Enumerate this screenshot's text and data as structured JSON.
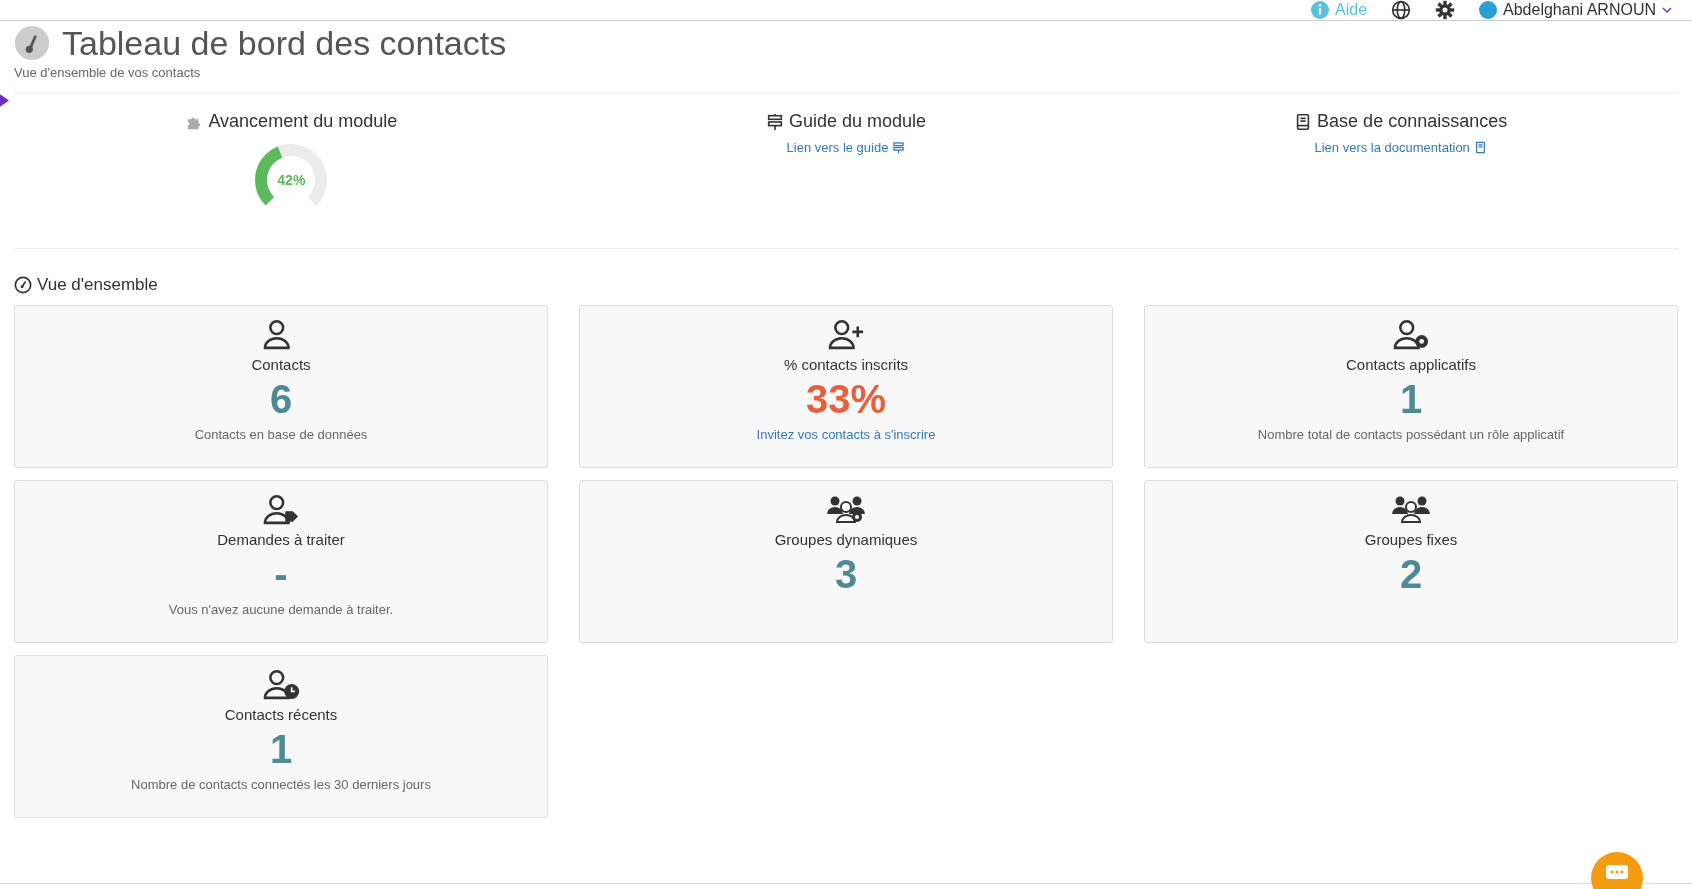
{
  "top_bar": {
    "help": "Aide",
    "user": "Abdelghani ARNOUN"
  },
  "header": {
    "title": "Tableau de bord des contacts",
    "subtitle": "Vue d'ensemble de vos contacts"
  },
  "module": {
    "progress": {
      "title": "Avancement du module",
      "level": 0.42,
      "reading": "42%"
    },
    "guide": {
      "title": "Guide du module",
      "link": "Lien vers le guide"
    },
    "docs": {
      "title": "Base de connaissances",
      "link": "Lien vers la documentation"
    }
  },
  "overview": {
    "title": "Vue d'ensemble",
    "cards": [
      {
        "kind": "person",
        "title": "Contacts",
        "value": "6",
        "color": "#4e8a96",
        "note": {
          "kind": "text",
          "text": "Contacts en base de données"
        }
      },
      {
        "kind": "person-plus",
        "title": "% contacts inscrits",
        "value": "33%",
        "color": "#e5603d",
        "note": {
          "kind": "link",
          "text": "Invitez vos contacts à s'inscrire"
        }
      },
      {
        "kind": "person-gear",
        "title": "Contacts applicatifs",
        "value": "1",
        "color": "#4e8a96",
        "note": {
          "kind": "text",
          "text": "Nombre total de contacts possédant un rôle applicatif"
        }
      },
      {
        "kind": "person-tag",
        "title": "Demandes à traiter",
        "value": "-",
        "color": "#4e8a96",
        "note": {
          "kind": "text",
          "text": "Vous n'avez aucune demande à traiter."
        }
      },
      {
        "kind": "group-gear",
        "title": "Groupes dynamiques",
        "value": "3",
        "color": "#4e8a96"
      },
      {
        "kind": "group",
        "title": "Groupes fixes",
        "value": "2",
        "color": "#4e8a96"
      },
      {
        "kind": "person-clock",
        "title": "Contacts récents",
        "value": "1",
        "color": "#4e8a96",
        "note": {
          "kind": "text",
          "text": "Nombre de contacts connectés les 30 derniers jours"
        }
      }
    ]
  }
}
